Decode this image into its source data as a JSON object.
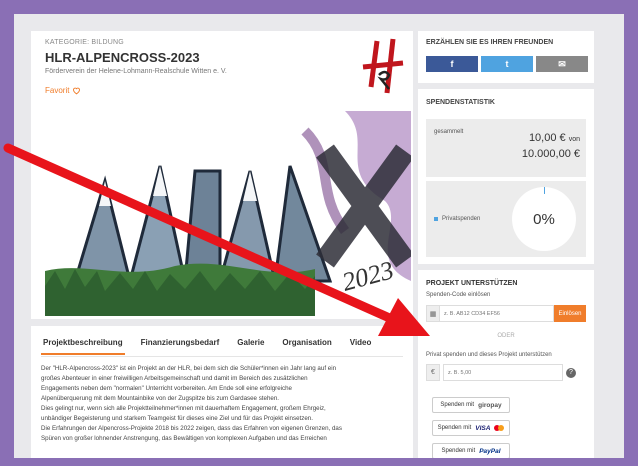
{
  "project": {
    "category": "KATEGORIE: BILDUNG",
    "title": "HLR-ALPENCROSS-2023",
    "organization": "Förderverein der Helene-Lohmann-Realschule Witten e. V.",
    "favorite_label": "Favorit",
    "hero_text": "ALPEN",
    "hero_side_text": "CROSS",
    "hero_year": "2023"
  },
  "tabs": [
    {
      "label": "Projektbeschreibung",
      "active": true
    },
    {
      "label": "Finanzierungsbedarf",
      "active": false
    },
    {
      "label": "Galerie",
      "active": false
    },
    {
      "label": "Organisation",
      "active": false
    },
    {
      "label": "Video",
      "active": false
    }
  ],
  "description": [
    "Der \"HLR-Alpencross-2023\" ist ein Projekt an der HLR, bei dem sich die Schüler*innen ein Jahr lang auf ein",
    "großes Abenteuer in einer freiwilligen Arbeitsgemeinschaft und damit im Bereich des zusätzlichen",
    "Engagements neben dem \"normalen\" Unterricht vorbereiten. Am Ende soll eine erfolgreiche",
    "Alpenüberquerung mit dem Mountainbike von der Zugspitze bis zum Gardasee stehen.",
    "Dies gelingt nur, wenn sich alle Projektteilnehmer*innen mit dauerhaftem Engagement, großem Ehrgeiz,",
    "unbändiger Begeisterung und starkem Teamgeist für dieses eine Ziel und für das Projekt einsetzen.",
    "Die Erfahrungen der Alpencross-Projekte 2018 bis 2022 zeigen, dass das Erfahren von eigenen Grenzen, das",
    "Spüren von großer lohnender Anstrengung, das Bewältigen von komplexen Aufgaben und das Erreichen"
  ],
  "share": {
    "title": "ERZÄHLEN SIE ES IHREN FREUNDEN",
    "facebook": "f",
    "twitter": "t",
    "mail": "✉"
  },
  "stats": {
    "title": "SPENDENSTATISTIK",
    "collected_label": "gesammelt",
    "collected_amount": "10,00 €",
    "of_label": "von",
    "goal_amount": "10.000,00 €",
    "legend_label": "Privatspenden",
    "percent": "0%",
    "progress_fraction": 0.001
  },
  "support": {
    "title": "PROJEKT UNTERSTÜTZEN",
    "code_label": "Spenden-Code einlösen",
    "code_placeholder": "z. B. AB12 CD34 EF56",
    "code_button": "Einlösen",
    "or_label": "ODER",
    "private_label": "Privat spenden und dieses Projekt unterstützen",
    "currency_symbol": "€",
    "amount_placeholder": "z. B. 5,00",
    "help_symbol": "?",
    "pay_prefix": "Spenden mit",
    "pay_giropay": "giropay",
    "pay_visa": "VISA",
    "pay_paypal": "PayPal"
  },
  "colors": {
    "accent": "#f07d2b",
    "facebook": "#3b5998",
    "twitter": "#4fa3e0",
    "arrow": "#e8141b",
    "border_frame": "#8a6fb5"
  }
}
